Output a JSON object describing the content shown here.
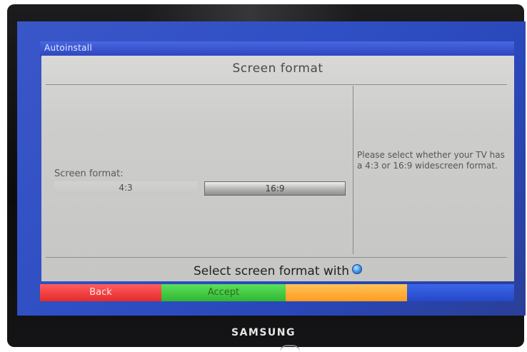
{
  "window": {
    "title": "Autoinstall"
  },
  "dialog": {
    "heading": "Screen format",
    "field_label": "Screen format:",
    "options": [
      {
        "label": "4:3",
        "selected": false
      },
      {
        "label": "16:9",
        "selected": true
      }
    ],
    "help_text": "Please select whether your TV has a 4:3 or 16:9 widescreen format.",
    "hint_text": "Select screen format with",
    "hint_icon": "blue-dot-icon"
  },
  "color_keys": {
    "red": "Back",
    "green": "Accept",
    "yellow": "",
    "blue": ""
  },
  "colors": {
    "panel": "#cfcfcd",
    "background": "#2f4fc4",
    "red": "#e52a2a",
    "green": "#31b631",
    "yellow": "#ff9b1e",
    "blue": "#2448c8"
  },
  "tv": {
    "brand": "SAMSUNG"
  }
}
